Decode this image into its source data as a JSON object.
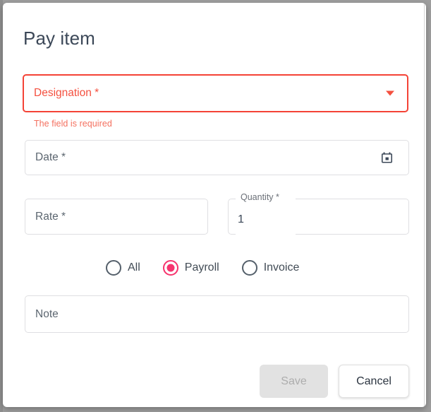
{
  "dialog": {
    "title": "Pay item"
  },
  "fields": {
    "designation": {
      "label": "Designation *",
      "value": "",
      "error": "The field is required",
      "icon": "chevron-down-icon"
    },
    "date": {
      "label": "Date *",
      "value": "",
      "icon": "calendar-icon"
    },
    "rate": {
      "label": "Rate *",
      "value": ""
    },
    "quantity": {
      "label": "Quantity *",
      "value": "1"
    },
    "note": {
      "label": "Note",
      "value": ""
    }
  },
  "radio_group": {
    "name": "pay-item-type",
    "selected": "Payroll",
    "options": [
      {
        "label": "All",
        "checked": false
      },
      {
        "label": "Payroll",
        "checked": true
      },
      {
        "label": "Invoice",
        "checked": false
      }
    ]
  },
  "actions": {
    "save_label": "Save",
    "save_disabled": true,
    "cancel_label": "Cancel"
  },
  "colors": {
    "error": "#f4503f",
    "error_text": "#f4705f",
    "accent_pink": "#f6346e",
    "title_text": "#3c4858",
    "field_border": "#dfdfe2",
    "disabled_bg": "#e2e2e2",
    "disabled_text": "#adadad",
    "backdrop": "#9e9e9e"
  }
}
